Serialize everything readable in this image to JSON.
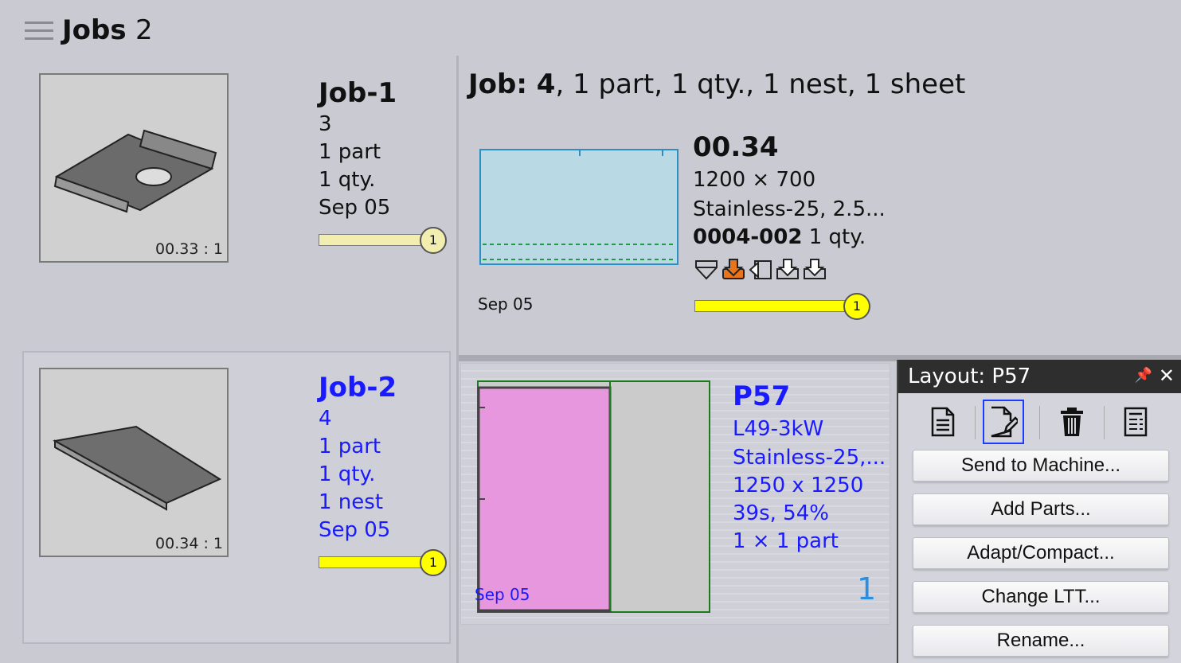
{
  "header": {
    "title": "Jobs",
    "count": "2"
  },
  "jobs": [
    {
      "thumb_label": "00.33 : 1",
      "title": "Job-1",
      "number": "3",
      "parts": "1 part",
      "qty": "1 qty.",
      "date": "Sep 05",
      "progress_badge": "1",
      "progress_color": "#f2eeb0"
    },
    {
      "thumb_label": "00.34 : 1",
      "title": "Job-2",
      "number": "4",
      "parts": "1 part",
      "qty": "1 qty.",
      "nests": "1 nest",
      "date": "Sep 05",
      "progress_badge": "1",
      "progress_color": "#ffff00"
    }
  ],
  "detail": {
    "heading_bold": "Job: 4",
    "heading_rest": ", 1 part, 1 qty., 1 nest, 1 sheet",
    "sheet_date": "Sep 05",
    "nest_name": "00.34",
    "sheet_size": "1200 × 700",
    "material": "Stainless-25, 2.5...",
    "part_id": "0004-002",
    "part_qty": "1 qty.",
    "progress_badge": "1",
    "op_icons": [
      "funnel-icon",
      "unload-arrow-icon",
      "side-unload-icon",
      "tray-down-icon",
      "tray-down-icon"
    ]
  },
  "layout": {
    "name": "P57",
    "machine": "L49-3kW",
    "material": "Stainless-25,...",
    "size": "1250 x 1250",
    "time_util": "39s, 54%",
    "parts": "1 × 1 part",
    "date": "Sep 05",
    "count": "1"
  },
  "panel": {
    "title_prefix": "Layout:",
    "title_name": "P57",
    "pin": "📌",
    "close": "✕",
    "tools": [
      "document-icon",
      "edit-document-icon",
      "trash-icon",
      "report-icon"
    ],
    "buttons": [
      "Send to Machine...",
      "Add Parts...",
      "Adapt/Compact...",
      "Change LTT...",
      "Rename..."
    ]
  },
  "colors": {
    "background": "#cacad3",
    "accent_blue": "#1a1aff",
    "sheet_fill": "#b9d9e5",
    "part_fill": "#e797de"
  }
}
